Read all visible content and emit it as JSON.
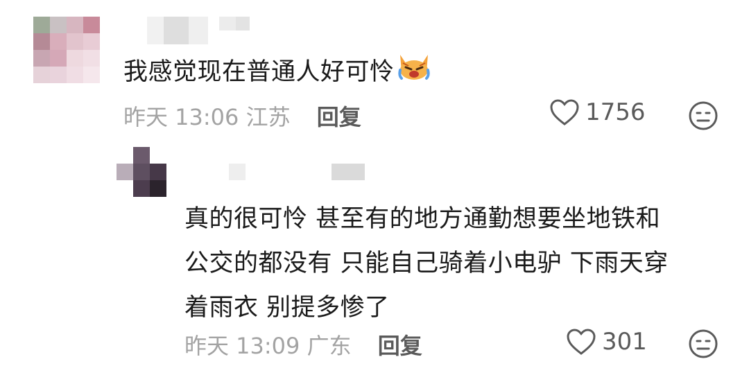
{
  "comments": [
    {
      "text": "我感觉现在普通人好可怜",
      "emoji": "crying-cat-emoji",
      "time": "昨天 13:06",
      "location": "江苏",
      "reply_label": "回复",
      "likes": "1756"
    },
    {
      "lines": [
        "真的很可怜 甚至有的地方通勤想要坐地铁和",
        "公交的都没有 只能自己骑着小电驴 下雨天穿",
        "着雨衣 别提多惨了"
      ],
      "time": "昨天 13:09",
      "location": "广东",
      "reply_label": "回复",
      "likes": "301"
    }
  ],
  "colors": {
    "text": "#1a1a1a",
    "meta": "#a3a3a3",
    "action": "#5a5a5a"
  }
}
